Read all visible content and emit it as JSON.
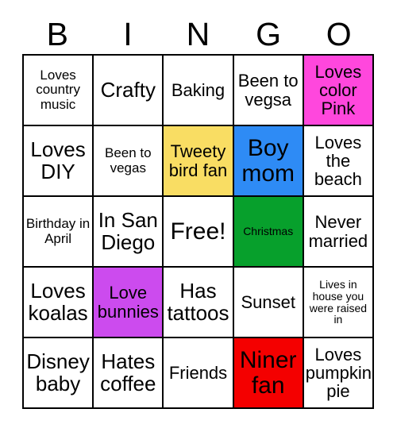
{
  "title": "BINGO Card",
  "header": {
    "letters": [
      "B",
      "I",
      "N",
      "G",
      "O"
    ]
  },
  "colors": {
    "pink": "#FF47DD",
    "yellow": "#F9DD63",
    "blue": "#2E8BF5",
    "green": "#07A02C",
    "purple": "#CC4BEE",
    "red": "#F40000",
    "white": "#FFFFFF",
    "border": "#000000",
    "text": "#000000"
  },
  "grid": {
    "rows": 5,
    "columns": 5,
    "cells": [
      {
        "text": "Loves country music",
        "bg": "#FFFFFF",
        "size": "fs-sm"
      },
      {
        "text": "Crafty",
        "bg": "#FFFFFF",
        "size": "fs-lg"
      },
      {
        "text": "Baking",
        "bg": "#FFFFFF",
        "size": "fs-md"
      },
      {
        "text": "Been to vegsa",
        "bg": "#FFFFFF",
        "size": "fs-md"
      },
      {
        "text": "Loves color Pink",
        "bg": "#FF47DD",
        "size": "fs-md"
      },
      {
        "text": "Loves DIY",
        "bg": "#FFFFFF",
        "size": "fs-lg"
      },
      {
        "text": "Been to vegas",
        "bg": "#FFFFFF",
        "size": "fs-sm"
      },
      {
        "text": "Tweety bird fan",
        "bg": "#F9DD63",
        "size": "fs-md"
      },
      {
        "text": "Boy mom",
        "bg": "#2E8BF5",
        "size": "fs-xl"
      },
      {
        "text": "Loves the beach",
        "bg": "#FFFFFF",
        "size": "fs-md"
      },
      {
        "text": "Birthday in April",
        "bg": "#FFFFFF",
        "size": "fs-sm"
      },
      {
        "text": "In San Diego",
        "bg": "#FFFFFF",
        "size": "fs-lg"
      },
      {
        "text": "Free!",
        "bg": "#FFFFFF",
        "size": "fs-xl"
      },
      {
        "text": "Christmas",
        "bg": "#07A02C",
        "size": "fs-xs"
      },
      {
        "text": "Never married",
        "bg": "#FFFFFF",
        "size": "fs-md"
      },
      {
        "text": "Loves koalas",
        "bg": "#FFFFFF",
        "size": "fs-lg"
      },
      {
        "text": "Love bunnies",
        "bg": "#CC4BEE",
        "size": "fs-md"
      },
      {
        "text": "Has tattoos",
        "bg": "#FFFFFF",
        "size": "fs-lg"
      },
      {
        "text": "Sunset",
        "bg": "#FFFFFF",
        "size": "fs-md"
      },
      {
        "text": "Lives in house you were raised in",
        "bg": "#FFFFFF",
        "size": "fs-xs"
      },
      {
        "text": "Disney baby",
        "bg": "#FFFFFF",
        "size": "fs-lg"
      },
      {
        "text": "Hates coffee",
        "bg": "#FFFFFF",
        "size": "fs-lg"
      },
      {
        "text": "Friends",
        "bg": "#FFFFFF",
        "size": "fs-md"
      },
      {
        "text": "Niner fan",
        "bg": "#F40000",
        "size": "fs-xl"
      },
      {
        "text": "Loves pumpkin pie",
        "bg": "#FFFFFF",
        "size": "fs-md"
      }
    ]
  }
}
